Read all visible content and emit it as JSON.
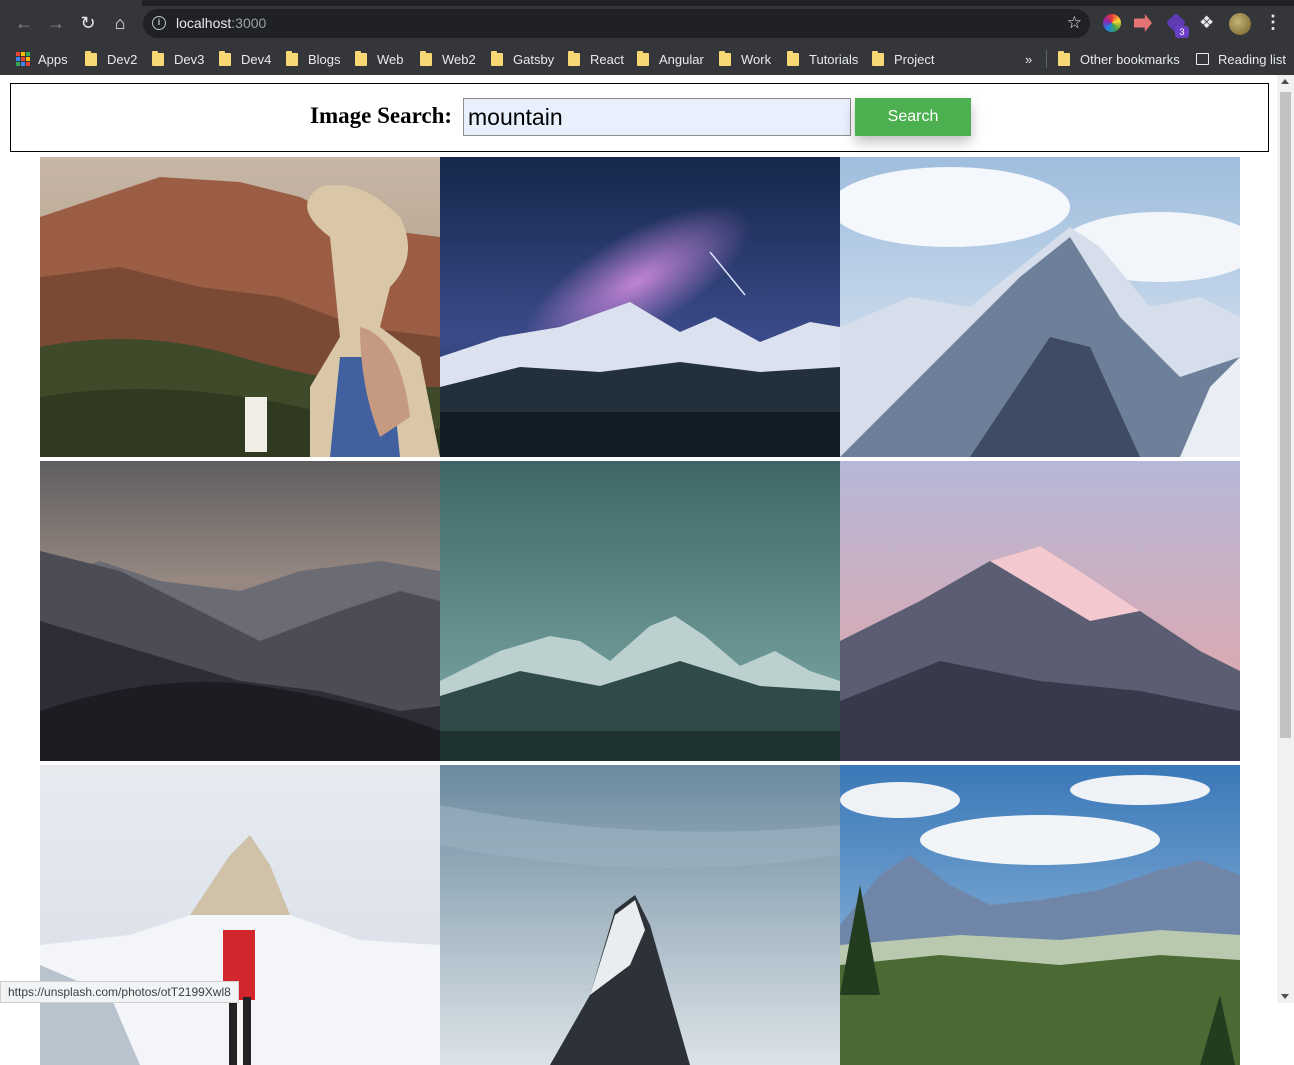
{
  "browser": {
    "url_host": "localhost",
    "url_port": ":3000",
    "extension_badge": "3"
  },
  "bookmarks": {
    "apps": "Apps",
    "items": [
      "Dev2",
      "Dev3",
      "Dev4",
      "Blogs",
      "Web",
      "Web2",
      "Gatsby",
      "React",
      "Angular",
      "Work",
      "Tutorials",
      "Project"
    ],
    "overflow": "»",
    "other": "Other bookmarks",
    "reading_list": "Reading list"
  },
  "search": {
    "label": "Image Search:",
    "value": "mountain",
    "button_label": "Search"
  },
  "images": [
    {
      "icon": "woman-at-canyon-photo"
    },
    {
      "icon": "milky-way-mountains-photo"
    },
    {
      "icon": "snowy-peaks-photo"
    },
    {
      "icon": "misty-ridges-photo"
    },
    {
      "icon": "teal-mountains-photo"
    },
    {
      "icon": "pink-peak-photo"
    },
    {
      "icon": "hiker-matterhorn-photo"
    },
    {
      "icon": "cloudy-summit-photo"
    },
    {
      "icon": "alpine-valley-photo"
    }
  ],
  "status_bar": {
    "link_url": "https://unsplash.com/photos/otT2199Xwl8"
  },
  "colors": {
    "chrome_dark": "#35363a",
    "search_button": "#4caf50",
    "input_bg": "#e8f0fe"
  }
}
